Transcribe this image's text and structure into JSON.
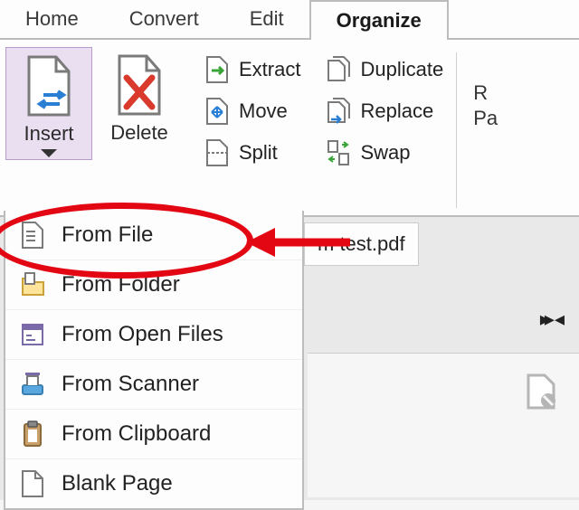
{
  "tabs": {
    "home": "Home",
    "convert": "Convert",
    "edit": "Edit",
    "organize": "Organize"
  },
  "ribbon": {
    "insert": {
      "label": "Insert"
    },
    "delete": {
      "label": "Delete"
    },
    "extract": {
      "label": "Extract"
    },
    "move": {
      "label": "Move"
    },
    "split": {
      "label": "Split"
    },
    "duplicate": {
      "label": "Duplicate"
    },
    "replace": {
      "label": "Replace"
    },
    "swap": {
      "label": "Swap"
    },
    "partial1": "R",
    "partial2": "Pa"
  },
  "insert_menu": {
    "from_file": "From File",
    "from_folder": "From Folder",
    "from_open_files": "From Open Files",
    "from_scanner": "From Scanner",
    "from_clipboard": "From Clipboard",
    "blank_page": "Blank Page"
  },
  "doc": {
    "tab_partial": "m test.pdf"
  }
}
